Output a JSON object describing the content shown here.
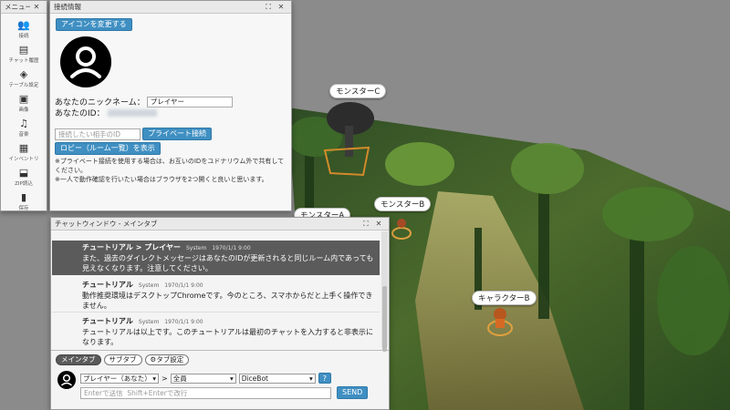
{
  "menu_window": {
    "title": "メニュー",
    "items": [
      {
        "label": "接続",
        "icon": "people-icon",
        "glyph": "👥"
      },
      {
        "label": "チャット履歴",
        "icon": "chat-history-icon",
        "glyph": "▤"
      },
      {
        "label": "テーブル設定",
        "icon": "layers-icon",
        "glyph": "◈"
      },
      {
        "label": "画像",
        "icon": "image-icon",
        "glyph": "▣"
      },
      {
        "label": "音楽",
        "icon": "music-icon",
        "glyph": "♫"
      },
      {
        "label": "インベントリ",
        "icon": "inventory-icon",
        "glyph": "▦"
      },
      {
        "label": "ZIP読込",
        "icon": "zip-load-icon",
        "glyph": "⬓"
      },
      {
        "label": "保存",
        "icon": "save-icon",
        "glyph": "▮"
      }
    ]
  },
  "connection_window": {
    "title": "接続情報",
    "change_icon_button": "アイコンを変更する",
    "nickname_label": "あなたのニックネーム：",
    "nickname_value": "プレイヤー",
    "id_label": "あなたのID：",
    "target_id_placeholder": "接続したい相手のID",
    "private_connect_button": "プライベート接続",
    "lobby_button": "ロビー（ルーム一覧）を表示",
    "note1": "※プライベート接続を使用する場合は、お互いのIDをユドナリウム外で共有してください。",
    "note2": "※一人で動作確認を行いたい場合はブラウザを2つ開くと良いと思います。"
  },
  "scene": {
    "tokens": [
      {
        "label": "モンスターC"
      },
      {
        "label": "モンスターB"
      },
      {
        "label": "モンスターA"
      },
      {
        "label": "キャラクターB"
      }
    ]
  },
  "chat_window": {
    "title": "チャットウィンドウ - メインタブ",
    "messages": [
      {
        "name": "チュートリアル > プレイヤー",
        "sys": "System",
        "time": "1970/1/1 9:00",
        "body": "また、過去のダイレクトメッセージはあなたのIDが更新されると同じルーム内であっても見えなくなります。注意してください。"
      },
      {
        "name": "チュートリアル",
        "sys": "System",
        "time": "1970/1/1 9:00",
        "body": "動作推奨環境はデスクトップChromeです。今のところ、スマホからだと上手く操作できません。"
      },
      {
        "name": "チュートリアル",
        "sys": "System",
        "time": "1970/1/1 9:00",
        "body": "チュートリアルは以上です。このチュートリアルは最初のチャットを入力すると非表示になります。"
      }
    ],
    "tabs": [
      "メインタブ",
      "サブタブ",
      "タブ設定"
    ],
    "sender_select": "プレイヤー（あなた）",
    "arrow": ">",
    "target_select": "全員",
    "dice_select": "DiceBot",
    "help_button": "?",
    "input_placeholder": "Enterで送信  Shift+Enterで改行",
    "send_button": "SEND"
  }
}
